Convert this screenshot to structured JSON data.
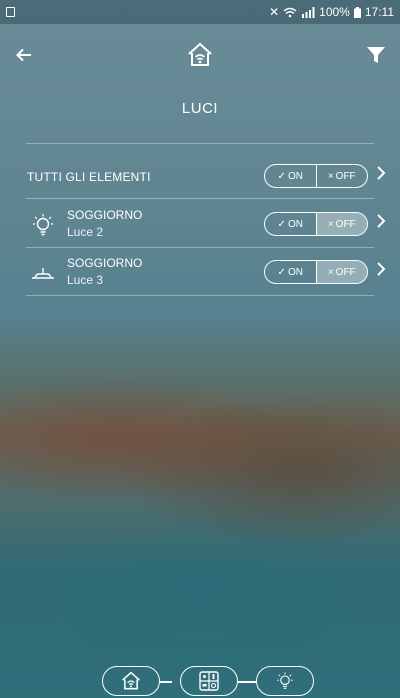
{
  "status_bar": {
    "battery": "100%",
    "time": "17:11"
  },
  "header": {
    "back_icon": "arrow-left-icon",
    "home_icon": "smart-home-icon",
    "filter_icon": "filter-icon",
    "title": "LUCI"
  },
  "all_elements": {
    "label": "TUTTI GLI ELEMENTI",
    "on_label": "ON",
    "off_label": "OFF",
    "on_symbol": "✓",
    "off_symbol": "×"
  },
  "devices": [
    {
      "room": "SOGGIORNO",
      "name": "Luce 2",
      "icon": "light-bulb-icon",
      "state": "OFF",
      "on_label": "ON",
      "off_label": "OFF",
      "on_symbol": "✓",
      "off_symbol": "×"
    },
    {
      "room": "SOGGIORNO",
      "name": "Luce 3",
      "icon": "ceiling-light-icon",
      "state": "OFF",
      "on_label": "ON",
      "off_label": "OFF",
      "on_symbol": "✓",
      "off_symbol": "×"
    }
  ],
  "bottom_nav": [
    {
      "icon": "home-icon"
    },
    {
      "icon": "devices-panel-icon"
    },
    {
      "icon": "light-bulb-icon"
    }
  ]
}
